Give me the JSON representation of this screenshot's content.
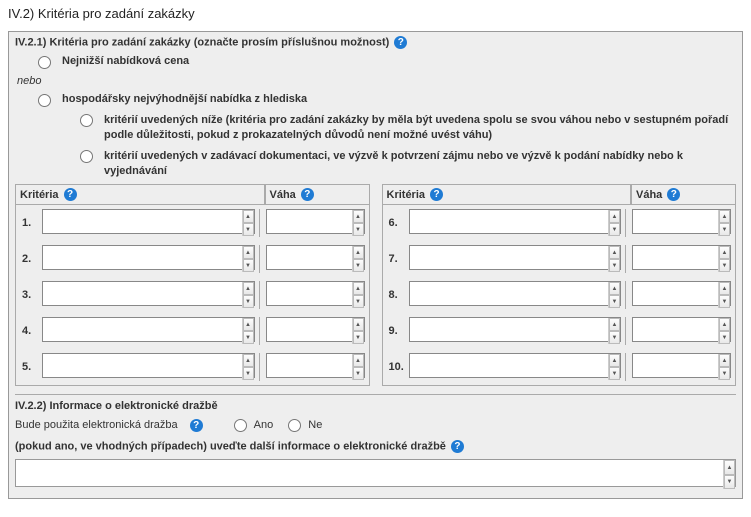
{
  "section_title": "IV.2) Kritéria pro zadání zakázky",
  "iv21": {
    "header": "IV.2.1) Kritéria pro zadání zakázky (označte prosím příslušnou možnost)",
    "opt_price": "Nejnižší nabídková cena",
    "nebo": "nebo",
    "opt_econ": "hospodářsky nejvýhodnější nabídka z hlediska",
    "opt_below": "kritérií uvedených níže (kritéria pro zadání zakázky by měla být uvedena spolu se svou váhou nebo v sestupném pořadí podle důležitosti, pokud z prokazatelných důvodů není možné uvést váhu)",
    "opt_docs": "kritérií uvedených v zadávací dokumentaci, ve výzvě k potvrzení zájmu nebo ve výzvě k podání nabídky nebo k vyjednávání",
    "col_kriteria": "Kritéria",
    "col_vaha": "Váha",
    "rows_left": [
      "1.",
      "2.",
      "3.",
      "4.",
      "5."
    ],
    "rows_right": [
      "6.",
      "7.",
      "8.",
      "9.",
      "10."
    ]
  },
  "iv22": {
    "header": "IV.2.2) Informace o elektronické dražbě",
    "question": "Bude použita elektronická dražba",
    "yes": "Ano",
    "no": "Ne",
    "more_info": "(pokud ano, ve vhodných případech) uveďte další informace o elektronické dražbě"
  }
}
